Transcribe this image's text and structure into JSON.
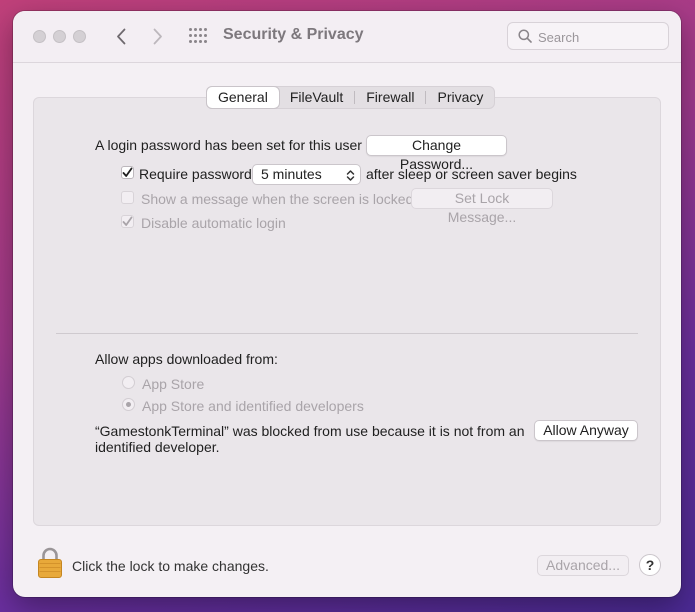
{
  "window": {
    "title": "Security & Privacy",
    "search_placeholder": "Search"
  },
  "tabs": [
    {
      "label": "General",
      "active": true
    },
    {
      "label": "FileVault",
      "active": false
    },
    {
      "label": "Firewall",
      "active": false
    },
    {
      "label": "Privacy",
      "active": false
    }
  ],
  "general": {
    "login_password_text": "A login password has been set for this user",
    "change_password_label": "Change Password...",
    "require_password_label": "Require password",
    "require_password_checked": true,
    "require_password_delay": "5 minutes",
    "after_sleep_text": "after sleep or screen saver begins",
    "show_message_label": "Show a message when the screen is locked",
    "show_message_checked": false,
    "set_lock_message_label": "Set Lock Message...",
    "disable_autologin_label": "Disable automatic login",
    "disable_autologin_checked": true,
    "allow_apps_heading": "Allow apps downloaded from:",
    "radio_app_store": "App Store",
    "radio_app_store_identified": "App Store and identified developers",
    "selected_radio": "App Store and identified developers",
    "blocked_line1": "“GamestonkTerminal” was blocked from use because it is not from an",
    "blocked_line2": "identified developer.",
    "allow_anyway_label": "Allow Anyway"
  },
  "footer": {
    "lock_text": "Click the lock to make changes.",
    "advanced_label": "Advanced...",
    "help_label": "?"
  },
  "icons": [
    "close-icon",
    "minimize-icon",
    "zoom-icon",
    "back-chevron-icon",
    "forward-chevron-icon",
    "grid-icon",
    "search-icon",
    "checkmark-icon",
    "up-down-chevron-icon",
    "lock-icon"
  ]
}
